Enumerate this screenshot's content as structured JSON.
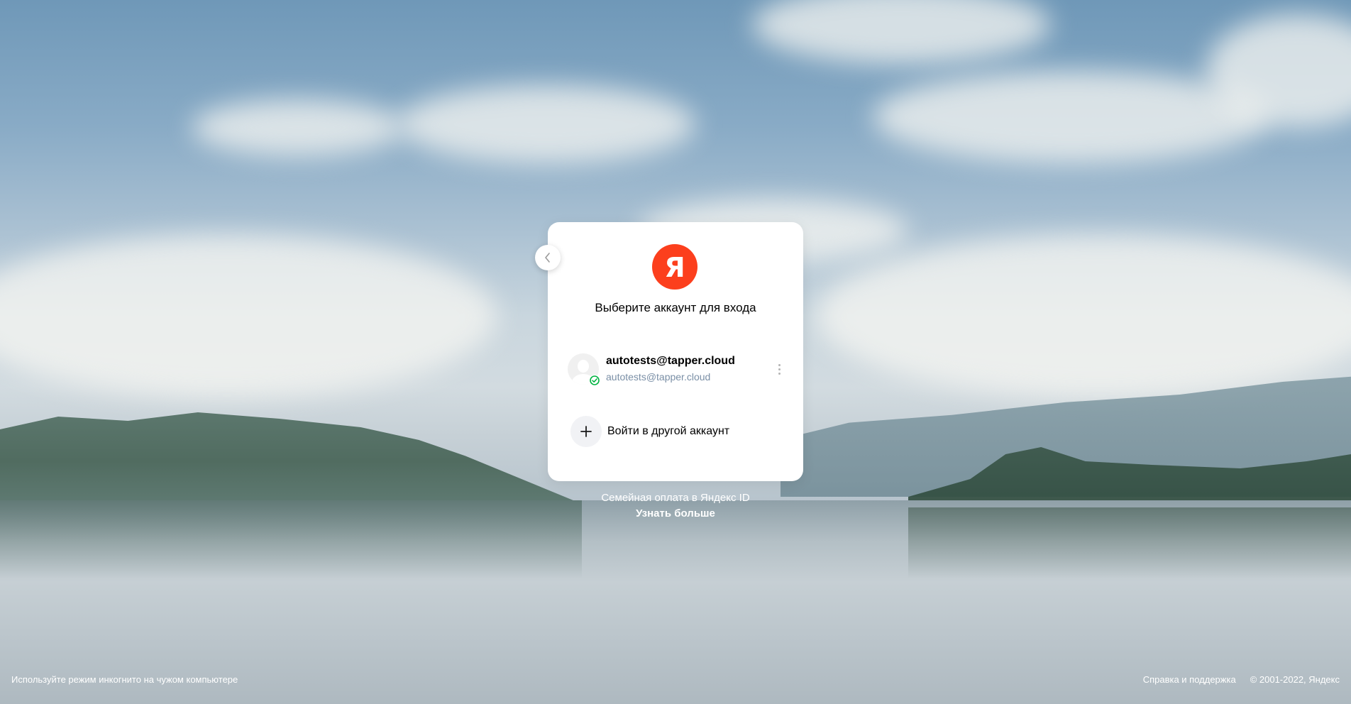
{
  "card": {
    "logo_letter": "Я",
    "title": "Выберите аккаунт для входа",
    "account": {
      "name": "autotests@tapper.cloud",
      "email": "autotests@tapper.cloud"
    },
    "add_account_label": "Войти в другой аккаунт"
  },
  "promo": {
    "text": "Семейная оплата в Яндекс ID",
    "link_label": "Узнать больше"
  },
  "footer": {
    "incognito_hint": "Используйте режим инкогнито на чужом компьютере",
    "help_link": "Справка и поддержка",
    "copyright": "© 2001-2022, Яндекс"
  },
  "colors": {
    "brand": "#fc3f1d",
    "verified": "#00b341",
    "email_text": "#7a8fa6"
  }
}
